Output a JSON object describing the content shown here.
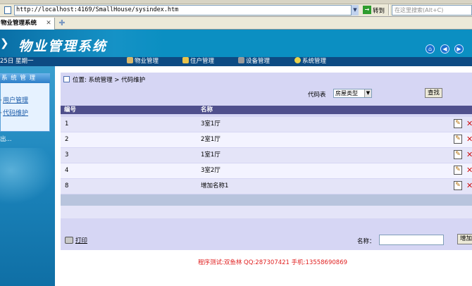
{
  "browser": {
    "url": "http://localhost:4169/SmallHouse/sysindex.htm",
    "go_label": "转到",
    "search_placeholder": "在这里搜索(Alt+C)",
    "tab_title": "物业管理系统"
  },
  "header": {
    "title": "物业管理系统",
    "date": "25日 星期一",
    "nav": [
      {
        "label": "物业管理",
        "icon": "building-icon"
      },
      {
        "label": "住户管理",
        "icon": "house-icon"
      },
      {
        "label": "设备管理",
        "icon": "tools-icon"
      },
      {
        "label": "系统管理",
        "icon": "users-icon"
      }
    ],
    "tool_icons": [
      "home-icon",
      "back-icon",
      "forward-icon"
    ]
  },
  "sidebar": {
    "panel_title": "系 统 管 理",
    "items": [
      {
        "label": "用户管理"
      },
      {
        "label": "代码维护"
      }
    ],
    "exit_label": "出..."
  },
  "main": {
    "breadcrumb": "位置: 系统管理 > 代码维护",
    "filter_label": "代码表",
    "filter_selected": "房屋类型",
    "search_button": "查找",
    "columns": [
      "编号",
      "名称"
    ],
    "rows": [
      {
        "id": "1",
        "name": "3室1厅"
      },
      {
        "id": "2",
        "name": "2室1厅"
      },
      {
        "id": "3",
        "name": "1室1厅"
      },
      {
        "id": "4",
        "name": "3室2厅"
      },
      {
        "id": "8",
        "name": "增加名称1"
      }
    ],
    "print_label": "打印",
    "name_label": "名称：",
    "name_value": "",
    "add_button": "增加"
  },
  "footer": {
    "text": "程序测试:双鱼林 QQ:287307421 手机:13558690869"
  },
  "colors": {
    "header_blue": "#0b8fc2",
    "nav_dark": "#0d4b83",
    "content_bg": "#d6d6f4",
    "table_head": "#4f4f8c",
    "footer_red": "#e02020"
  }
}
